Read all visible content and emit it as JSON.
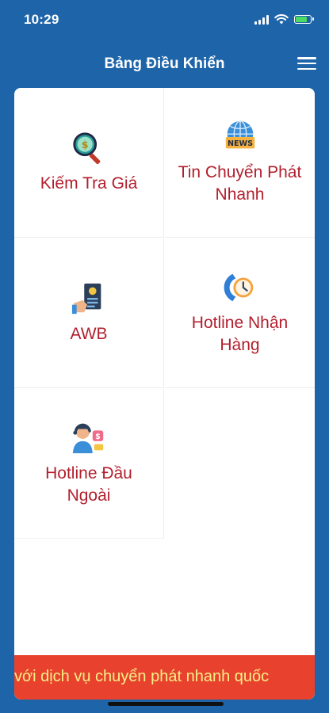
{
  "status_bar": {
    "time": "10:29"
  },
  "header": {
    "title": "Bảng Điều Khiển",
    "menu_icon": "hamburger-icon"
  },
  "tiles": [
    {
      "label": "Kiếm Tra Giá",
      "icon": "magnifier-money-icon"
    },
    {
      "label": "Tin Chuyển Phát Nhanh",
      "icon": "globe-news-icon"
    },
    {
      "label": "AWB",
      "icon": "document-hand-icon"
    },
    {
      "label": "Hotline Nhận Hàng",
      "icon": "phone-clock-icon"
    },
    {
      "label": "Hotline Đầu Ngoài",
      "icon": "support-agent-icon"
    }
  ],
  "banner": {
    "text": "với dịch vụ chuyển phát nhanh quốc"
  },
  "colors": {
    "background": "#1d64a8",
    "tile_text": "#b21f2d",
    "banner_bg": "#e8422e",
    "banner_text": "#f7ef86"
  }
}
